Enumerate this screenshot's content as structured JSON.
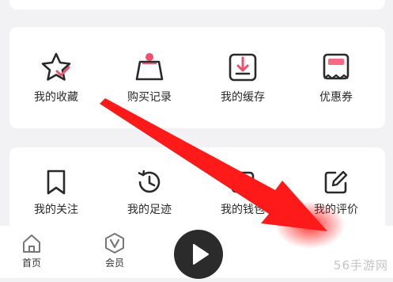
{
  "section_one": {
    "items": [
      {
        "label": "我的收藏",
        "icon": "star-icon"
      },
      {
        "label": "购买记录",
        "icon": "shopping-bag-icon"
      },
      {
        "label": "我的缓存",
        "icon": "download-box-icon"
      },
      {
        "label": "优惠券",
        "icon": "coupon-icon"
      }
    ]
  },
  "section_two": {
    "items": [
      {
        "label": "我的关注",
        "icon": "bookmark-icon"
      },
      {
        "label": "我的足迹",
        "icon": "history-clock-icon"
      },
      {
        "label": "我的钱包",
        "icon": "wallet-icon"
      },
      {
        "label": "我的评价",
        "icon": "edit-icon"
      }
    ]
  },
  "tabbar": {
    "home_label": "首页",
    "vip_label": "会员",
    "play_icon": "play-icon"
  },
  "watermark": "56手游网",
  "colors": {
    "accent": "#f0506e",
    "arrow": "#ff1a1a",
    "background": "#f2f2f4",
    "card": "#ffffff",
    "icon": "#2a2a2a"
  }
}
